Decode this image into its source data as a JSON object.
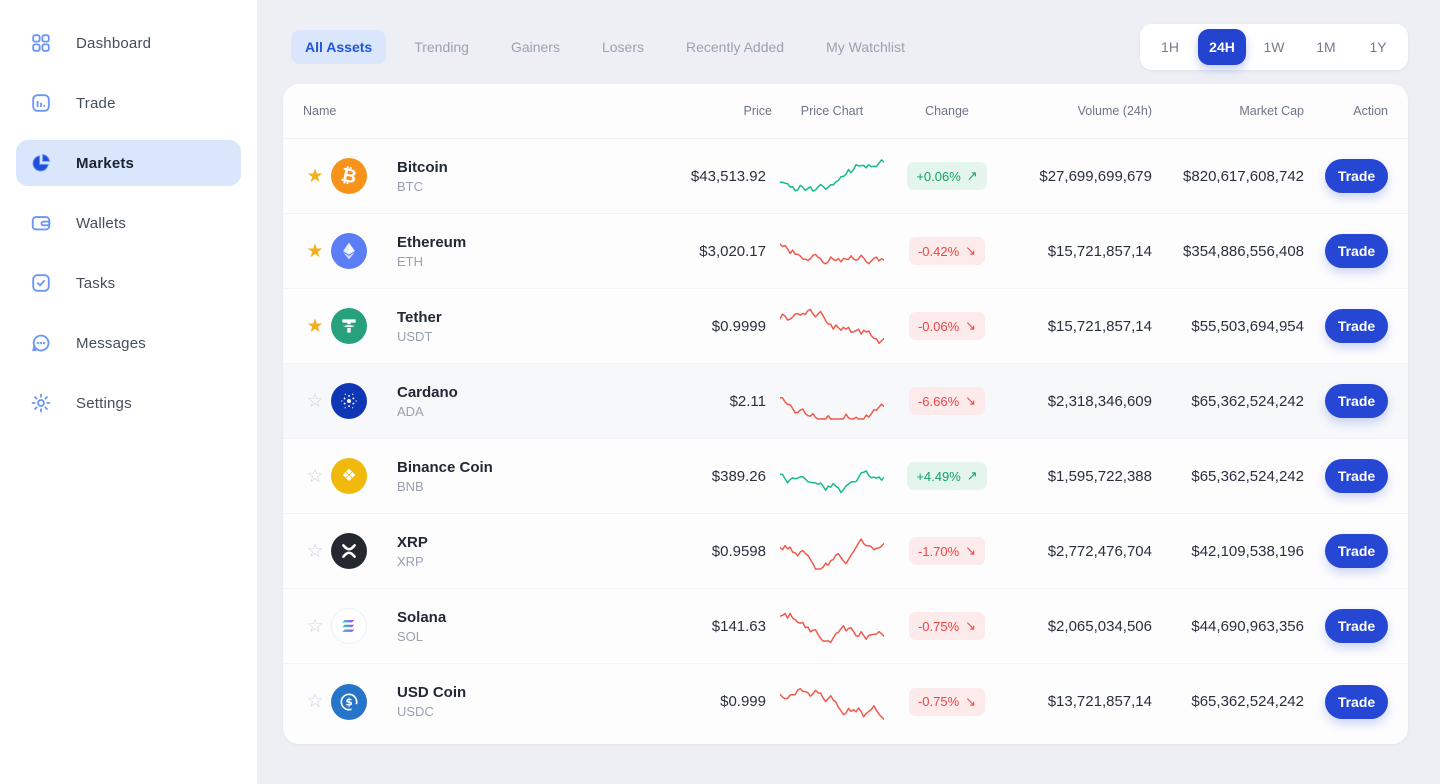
{
  "sidebar": {
    "items": [
      {
        "label": "Dashboard",
        "icon": "dashboard-grid-icon",
        "active": false
      },
      {
        "label": "Trade",
        "icon": "trade-barchart-icon",
        "active": false
      },
      {
        "label": "Markets",
        "icon": "markets-piechart-icon",
        "active": true
      },
      {
        "label": "Wallets",
        "icon": "wallet-icon",
        "active": false
      },
      {
        "label": "Tasks",
        "icon": "tasks-check-icon",
        "active": false
      },
      {
        "label": "Messages",
        "icon": "messages-chat-icon",
        "active": false
      },
      {
        "label": "Settings",
        "icon": "settings-gear-icon",
        "active": false
      }
    ]
  },
  "tabs": [
    {
      "label": "All Assets",
      "active": true
    },
    {
      "label": "Trending",
      "active": false
    },
    {
      "label": "Gainers",
      "active": false
    },
    {
      "label": "Losers",
      "active": false
    },
    {
      "label": "Recently Added",
      "active": false
    },
    {
      "label": "My Watchlist",
      "active": false
    }
  ],
  "time_ranges": [
    {
      "label": "1H",
      "active": false
    },
    {
      "label": "24H",
      "active": true
    },
    {
      "label": "1W",
      "active": false
    },
    {
      "label": "1M",
      "active": false
    },
    {
      "label": "1Y",
      "active": false
    }
  ],
  "glyphs": {
    "up_arrow": "↗",
    "down_arrow": "↘",
    "star_filled": "★",
    "star_outline": "☆"
  },
  "colors": {
    "accent_blue": "#2443cf",
    "green": "#16bd81",
    "red": "#f05a4c",
    "badge_green_text": "#12a269",
    "badge_red_text": "#ef4545",
    "star_yellow": "#f3b01e"
  },
  "table": {
    "columns": [
      "Name",
      "Price",
      "Price Chart",
      "Change",
      "Volume (24h)",
      "Market Cap",
      "Action"
    ],
    "action_label": "Trade",
    "rows": [
      {
        "name": "Bitcoin",
        "symbol": "BTC",
        "icon": "btc-coin-icon",
        "icon_bg": "#f7931a",
        "starred": true,
        "highlighted": false,
        "price": "$43,513.92",
        "change": "+0.06%",
        "direction": "up",
        "volume": "$27,699,699,679",
        "market_cap": "$820,617,608,742"
      },
      {
        "name": "Ethereum",
        "symbol": "ETH",
        "icon": "eth-coin-icon",
        "icon_bg": "#5b7ef7",
        "starred": true,
        "highlighted": false,
        "price": "$3,020.17",
        "change": "-0.42%",
        "direction": "down",
        "volume": "$15,721,857,14",
        "market_cap": "$354,886,556,408"
      },
      {
        "name": "Tether",
        "symbol": "USDT",
        "icon": "usdt-coin-icon",
        "icon_bg": "#26a17b",
        "starred": true,
        "highlighted": false,
        "price": "$0.9999",
        "change": "-0.06%",
        "direction": "down",
        "volume": "$15,721,857,14",
        "market_cap": "$55,503,694,954"
      },
      {
        "name": "Cardano",
        "symbol": "ADA",
        "icon": "ada-coin-icon",
        "icon_bg": "#0f36b4",
        "starred": false,
        "highlighted": true,
        "price": "$2.11",
        "change": "-6.66%",
        "direction": "down",
        "volume": "$2,318,346,609",
        "market_cap": "$65,362,524,242"
      },
      {
        "name": "Binance Coin",
        "symbol": "BNB",
        "icon": "bnb-coin-icon",
        "icon_bg": "#f0b90b",
        "starred": false,
        "highlighted": false,
        "price": "$389.26",
        "change": "+4.49%",
        "direction": "up",
        "volume": "$1,595,722,388",
        "market_cap": "$65,362,524,242"
      },
      {
        "name": "XRP",
        "symbol": "XRP",
        "icon": "xrp-coin-icon",
        "icon_bg": "#23292f",
        "starred": false,
        "highlighted": false,
        "price": "$0.9598",
        "change": "-1.70%",
        "direction": "down",
        "volume": "$2,772,476,704",
        "market_cap": "$42,109,538,196"
      },
      {
        "name": "Solana",
        "symbol": "SOL",
        "icon": "sol-coin-icon",
        "icon_bg": "#ffffff",
        "starred": false,
        "highlighted": false,
        "price": "$141.63",
        "change": "-0.75%",
        "direction": "down",
        "volume": "$2,065,034,506",
        "market_cap": "$44,690,963,356"
      },
      {
        "name": "USD Coin",
        "symbol": "USDC",
        "icon": "usdc-coin-icon",
        "icon_bg": "#2775ca",
        "starred": false,
        "highlighted": false,
        "price": "$0.999",
        "change": "-0.75%",
        "direction": "down",
        "volume": "$13,721,857,14",
        "market_cap": "$65,362,524,242"
      }
    ]
  }
}
